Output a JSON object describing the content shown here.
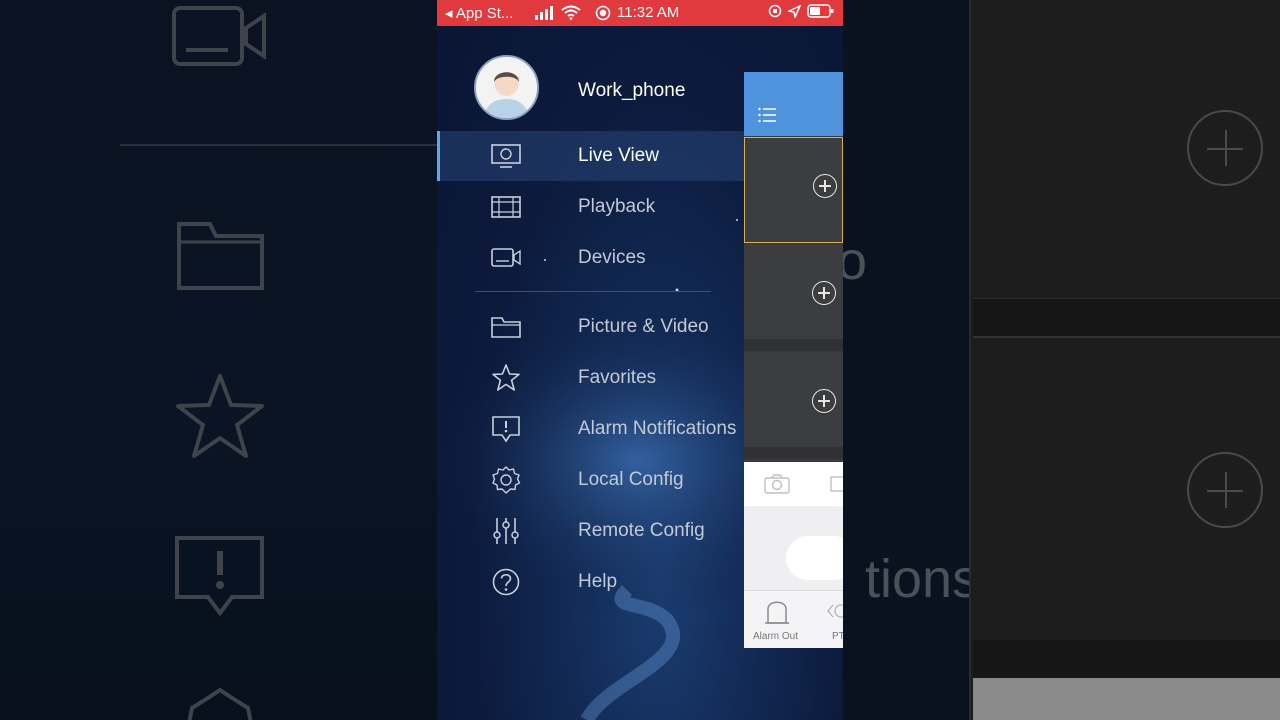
{
  "status_bar": {
    "back_app": "◂ App St...",
    "time": "11:32 AM",
    "bg_color": "#e03a3e"
  },
  "background": {
    "ghost_text": "tions",
    "ghost_text_2": "o"
  },
  "drawer": {
    "username": "Work_phone",
    "items_primary": [
      {
        "label": "Live View",
        "icon": "monitor-icon",
        "active": true
      },
      {
        "label": "Playback",
        "icon": "film-icon",
        "active": false
      },
      {
        "label": "Devices",
        "icon": "camera-icon",
        "active": false
      }
    ],
    "items_secondary": [
      {
        "label": "Picture & Video",
        "icon": "folder-icon"
      },
      {
        "label": "Favorites",
        "icon": "star-icon"
      },
      {
        "label": "Alarm Notifications",
        "icon": "alarm-icon"
      },
      {
        "label": "Local Config",
        "icon": "gear-icon"
      },
      {
        "label": "Remote Config",
        "icon": "sliders-icon"
      },
      {
        "label": "Help",
        "icon": "help-icon"
      }
    ],
    "accent_color": "#5fa8e8"
  },
  "live_view_panel": {
    "header_color": "#4f93dc",
    "bottom_tabs": [
      {
        "label": "Alarm Out",
        "icon": "siren-icon"
      },
      {
        "label": "PT",
        "icon": "ptz-icon"
      }
    ]
  }
}
